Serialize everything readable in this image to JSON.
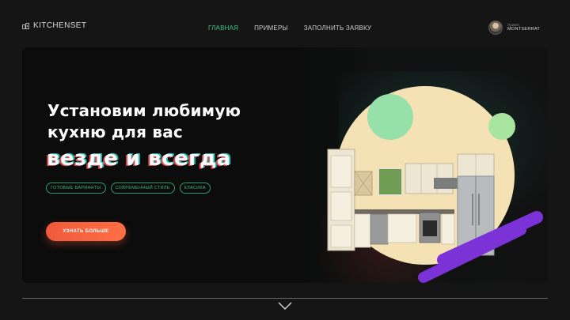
{
  "brand": {
    "name": "KITCHENSET",
    "icon": "kitchen-icon"
  },
  "nav": {
    "items": [
      {
        "label": "ГЛАВНАЯ",
        "active": true
      },
      {
        "label": "ПРИМЕРЫ",
        "active": false
      },
      {
        "label": "ЗАПОЛНИТЬ ЗАЯВКУ",
        "active": false
      }
    ]
  },
  "profile": {
    "greeting": "Привет,",
    "name": "MONTSERRAT",
    "avatar_icon": "user-avatar"
  },
  "hero": {
    "title_line1": "Установим любимую",
    "title_line2": "кухню для вас",
    "accent": "везде и всегда",
    "tags": [
      "ГОТОВЫЕ ВАРИАНТЫ",
      "СОВРЕМЕННЫЙ СТИЛЬ",
      "КЛАСИКА"
    ],
    "cta_label": "УЗНАТЬ БОЛЬШЕ"
  },
  "scroll_icon": "chevron-down-icon",
  "colors": {
    "accent_green": "#3fc58b",
    "cta_orange": "#f05a3b",
    "background": "#151515",
    "hero_panel": "#0c0c0c",
    "purple_stripe": "#7b32d6",
    "circle_cream": "#f4e2b4",
    "circle_mint": "#96e0a9"
  }
}
